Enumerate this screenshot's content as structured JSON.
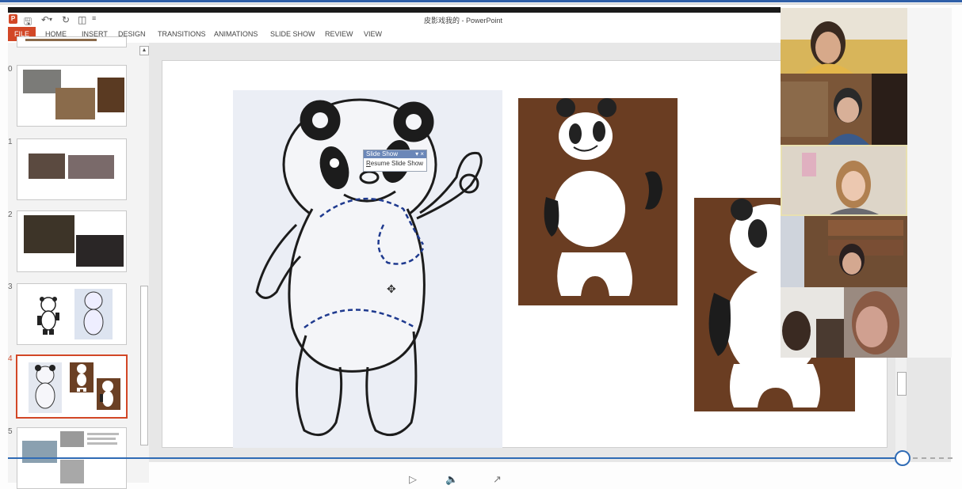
{
  "window": {
    "title": "皮影戏我的 - PowerPoint"
  },
  "ribbon": {
    "file_label": "FILE",
    "tabs": [
      "HOME",
      "INSERT",
      "DESIGN",
      "TRANSITIONS",
      "ANIMATIONS",
      "SLIDE SHOW",
      "REVIEW",
      "VIEW"
    ]
  },
  "thumbnails": {
    "slides": [
      {
        "num": "0"
      },
      {
        "num": "1"
      },
      {
        "num": "2"
      },
      {
        "num": "3"
      },
      {
        "num": "4",
        "selected": true
      },
      {
        "num": "5"
      }
    ]
  },
  "slideshow_menu": {
    "title": "Slide Show",
    "item": "Resume Slide Show",
    "accel": "R"
  },
  "colors": {
    "accent": "#d24726",
    "seek": "#2f6bb5"
  },
  "icons": {
    "play": "play-icon",
    "volume": "volume-icon",
    "fullscreen": "expand-icon"
  }
}
